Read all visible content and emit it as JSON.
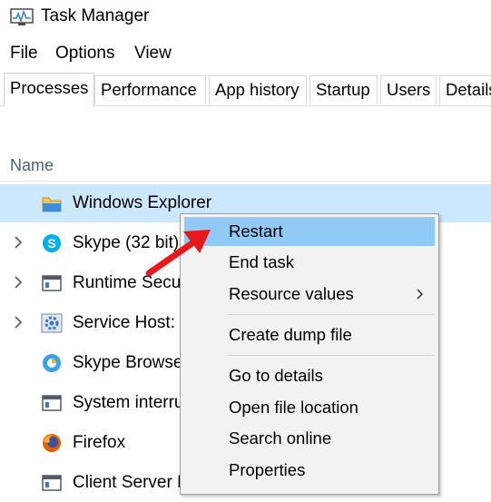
{
  "window": {
    "title": "Task Manager",
    "icon": "task-manager-icon"
  },
  "menu": {
    "items": [
      "File",
      "Options",
      "View"
    ]
  },
  "tabs": {
    "items": [
      "Processes",
      "Performance",
      "App history",
      "Startup",
      "Users",
      "Details"
    ],
    "active": "Processes"
  },
  "list": {
    "column_header": "Name",
    "rows": [
      {
        "label": "Windows Explorer",
        "icon": "folder-icon",
        "expandable": false,
        "selected": true
      },
      {
        "label": "Skype (32 bit)",
        "icon": "skype-icon",
        "expandable": true,
        "selected": false
      },
      {
        "label": "Runtime Secur",
        "icon": "window-app-icon",
        "expandable": true,
        "selected": false
      },
      {
        "label": "Service Host: S",
        "icon": "gear-icon",
        "expandable": true,
        "selected": false
      },
      {
        "label": "Skype Browser",
        "icon": "skype-browser-icon",
        "expandable": false,
        "selected": false
      },
      {
        "label": "System interru",
        "icon": "window-app-icon",
        "expandable": false,
        "selected": false
      },
      {
        "label": "Firefox",
        "icon": "firefox-icon",
        "expandable": false,
        "selected": false
      },
      {
        "label": "Client Server R",
        "icon": "window-app-icon",
        "expandable": false,
        "selected": false
      }
    ]
  },
  "context_menu": {
    "items": [
      "Restart",
      "End task",
      "Resource values",
      "Create dump file",
      "Go to details",
      "Open file location",
      "Search online",
      "Properties"
    ],
    "highlighted": "Restart",
    "submenu_item": "Resource values",
    "highlight_color": "#91c9f7"
  },
  "colors": {
    "selected_row": "#cce8ff",
    "header_text": "#4d6082",
    "annotation_arrow": "#e8191b"
  }
}
